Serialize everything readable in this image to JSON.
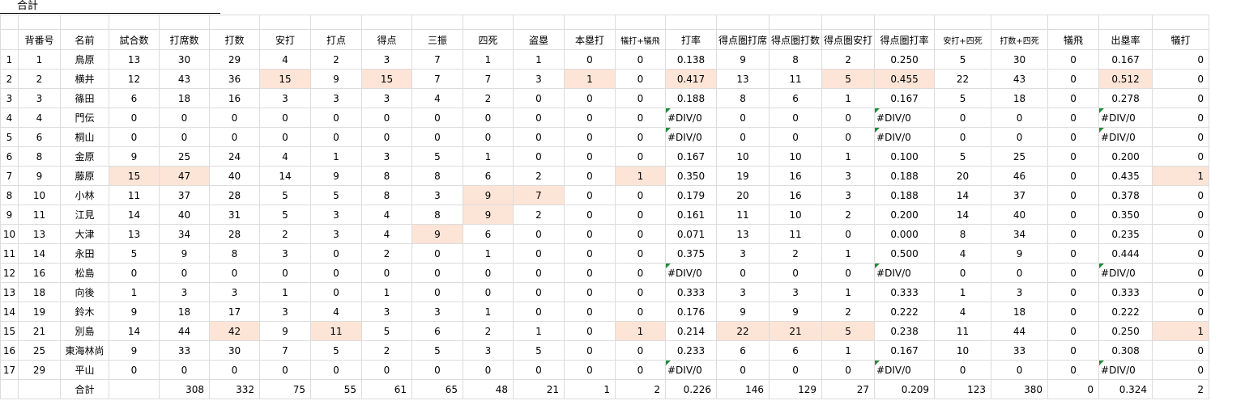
{
  "sheet": {
    "title": "合計",
    "columns": [
      "",
      "背番号",
      "名前",
      "試合数",
      "打席数",
      "打数",
      "安打",
      "打点",
      "得点",
      "三振",
      "四死",
      "盗塁",
      "本塁打",
      "犠打+犠飛",
      "打率",
      "得点圏打席",
      "得点圏打数",
      "得点圏安打",
      "得点圏打率",
      "安打+四死",
      "打数+四死",
      "犠飛",
      "出塁率",
      "犠打"
    ],
    "rows": [
      [
        "1",
        "1",
        "鳥原",
        "13",
        "30",
        "29",
        "4",
        "2",
        "3",
        "7",
        "1",
        "1",
        "0",
        "0",
        "0.138",
        "9",
        "8",
        "2",
        "0.250",
        "5",
        "30",
        "0",
        "0.167",
        "0"
      ],
      [
        "2",
        "2",
        "横井",
        "12",
        "43",
        "36",
        "15",
        "9",
        "15",
        "7",
        "7",
        "3",
        "1",
        "0",
        "0.417",
        "13",
        "11",
        "5",
        "0.455",
        "22",
        "43",
        "0",
        "0.512",
        "0"
      ],
      [
        "3",
        "3",
        "篠田",
        "6",
        "18",
        "16",
        "3",
        "3",
        "3",
        "4",
        "2",
        "0",
        "0",
        "0",
        "0.188",
        "8",
        "6",
        "1",
        "0.167",
        "5",
        "18",
        "0",
        "0.278",
        "0"
      ],
      [
        "4",
        "4",
        "門伝",
        "0",
        "0",
        "0",
        "0",
        "0",
        "0",
        "0",
        "0",
        "0",
        "0",
        "0",
        "#DIV/0",
        "0",
        "0",
        "0",
        "#DIV/0",
        "0",
        "0",
        "0",
        "#DIV/0",
        "0"
      ],
      [
        "5",
        "6",
        "桐山",
        "0",
        "0",
        "0",
        "0",
        "0",
        "0",
        "0",
        "0",
        "0",
        "0",
        "0",
        "#DIV/0",
        "0",
        "0",
        "0",
        "#DIV/0",
        "0",
        "0",
        "0",
        "#DIV/0",
        "0"
      ],
      [
        "6",
        "8",
        "金原",
        "9",
        "25",
        "24",
        "4",
        "1",
        "3",
        "5",
        "1",
        "0",
        "0",
        "0",
        "0.167",
        "10",
        "10",
        "1",
        "0.100",
        "5",
        "25",
        "0",
        "0.200",
        "0"
      ],
      [
        "7",
        "9",
        "藤原",
        "15",
        "47",
        "40",
        "14",
        "9",
        "8",
        "8",
        "6",
        "2",
        "0",
        "1",
        "0.350",
        "19",
        "16",
        "3",
        "0.188",
        "20",
        "46",
        "0",
        "0.435",
        "1"
      ],
      [
        "8",
        "10",
        "小林",
        "11",
        "37",
        "28",
        "5",
        "5",
        "8",
        "3",
        "9",
        "7",
        "0",
        "0",
        "0.179",
        "20",
        "16",
        "3",
        "0.188",
        "14",
        "37",
        "0",
        "0.378",
        "0"
      ],
      [
        "9",
        "11",
        "江見",
        "14",
        "40",
        "31",
        "5",
        "3",
        "4",
        "8",
        "9",
        "2",
        "0",
        "0",
        "0.161",
        "11",
        "10",
        "2",
        "0.200",
        "14",
        "40",
        "0",
        "0.350",
        "0"
      ],
      [
        "10",
        "13",
        "大津",
        "13",
        "34",
        "28",
        "2",
        "3",
        "4",
        "9",
        "6",
        "0",
        "0",
        "0",
        "0.071",
        "13",
        "11",
        "0",
        "0.000",
        "8",
        "34",
        "0",
        "0.235",
        "0"
      ],
      [
        "11",
        "14",
        "永田",
        "5",
        "9",
        "8",
        "3",
        "0",
        "2",
        "0",
        "1",
        "0",
        "0",
        "0",
        "0.375",
        "3",
        "2",
        "1",
        "0.500",
        "4",
        "9",
        "0",
        "0.444",
        "0"
      ],
      [
        "12",
        "16",
        "松島",
        "0",
        "0",
        "0",
        "0",
        "0",
        "0",
        "0",
        "0",
        "0",
        "0",
        "0",
        "#DIV/0",
        "0",
        "0",
        "0",
        "#DIV/0",
        "0",
        "0",
        "0",
        "#DIV/0",
        "0"
      ],
      [
        "13",
        "18",
        "向後",
        "1",
        "3",
        "3",
        "1",
        "0",
        "1",
        "0",
        "0",
        "0",
        "0",
        "0",
        "0.333",
        "3",
        "3",
        "1",
        "0.333",
        "1",
        "3",
        "0",
        "0.333",
        "0"
      ],
      [
        "14",
        "19",
        "鈴木",
        "9",
        "18",
        "17",
        "3",
        "4",
        "3",
        "3",
        "1",
        "0",
        "0",
        "0",
        "0.176",
        "9",
        "9",
        "2",
        "0.222",
        "4",
        "18",
        "0",
        "0.222",
        "0"
      ],
      [
        "15",
        "21",
        "別島",
        "14",
        "44",
        "42",
        "9",
        "11",
        "5",
        "6",
        "2",
        "1",
        "0",
        "1",
        "0.214",
        "22",
        "21",
        "5",
        "0.238",
        "11",
        "44",
        "0",
        "0.250",
        "1"
      ],
      [
        "16",
        "25",
        "東海林尚",
        "9",
        "33",
        "30",
        "7",
        "5",
        "2",
        "5",
        "3",
        "5",
        "0",
        "0",
        "0.233",
        "6",
        "6",
        "1",
        "0.167",
        "10",
        "33",
        "0",
        "0.308",
        "0"
      ],
      [
        "17",
        "29",
        "平山",
        "0",
        "0",
        "0",
        "0",
        "0",
        "0",
        "0",
        "0",
        "0",
        "0",
        "0",
        "#DIV/0",
        "0",
        "0",
        "0",
        "#DIV/0",
        "0",
        "0",
        "0",
        "#DIV/0",
        "0"
      ]
    ],
    "total": [
      "",
      "",
      "合計",
      "",
      "308",
      "332",
      "75",
      "55",
      "61",
      "65",
      "48",
      "21",
      "1",
      "2",
      "0.226",
      "146",
      "129",
      "27",
      "0.209",
      "123",
      "380",
      "0",
      "0.324",
      "2"
    ],
    "highlight_color": "#fce4d6",
    "error_marker_color": "#1e8c3a",
    "highlights": [
      [
        1,
        6
      ],
      [
        1,
        8
      ],
      [
        1,
        12
      ],
      [
        1,
        14
      ],
      [
        1,
        17
      ],
      [
        1,
        18
      ],
      [
        1,
        22
      ],
      [
        6,
        3
      ],
      [
        6,
        4
      ],
      [
        6,
        13
      ],
      [
        6,
        23
      ],
      [
        7,
        10
      ],
      [
        7,
        11
      ],
      [
        8,
        10
      ],
      [
        9,
        9
      ],
      [
        14,
        5
      ],
      [
        14,
        7
      ],
      [
        14,
        13
      ],
      [
        14,
        15
      ],
      [
        14,
        16
      ],
      [
        14,
        17
      ],
      [
        14,
        23
      ]
    ]
  }
}
